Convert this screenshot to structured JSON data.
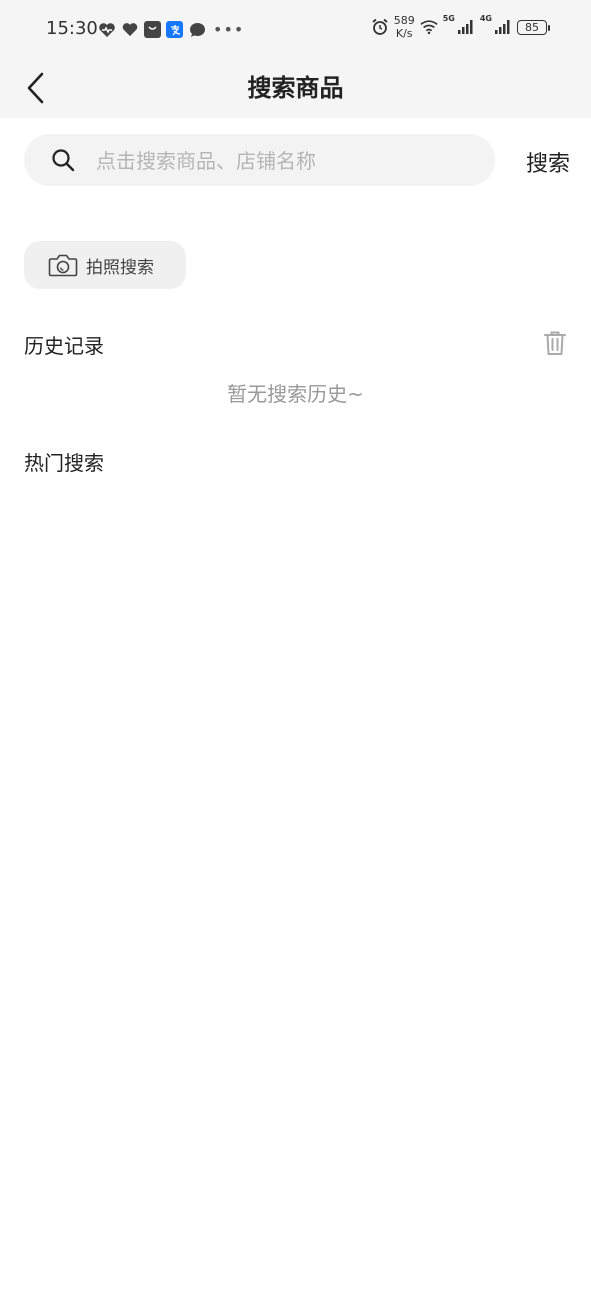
{
  "status_bar": {
    "time": "15:30",
    "net_speed_value": "589",
    "net_speed_unit": "K/s",
    "signal_1_label": "5G",
    "signal_2_label": "4G",
    "battery_level": "85"
  },
  "nav": {
    "title": "搜索商品"
  },
  "search": {
    "placeholder": "点击搜索商品、店铺名称",
    "button_label": "搜索"
  },
  "photo_search": {
    "label": "拍照搜索"
  },
  "history": {
    "title": "历史记录",
    "empty_text": "暂无搜索历史~"
  },
  "hot": {
    "title": "热门搜索"
  }
}
